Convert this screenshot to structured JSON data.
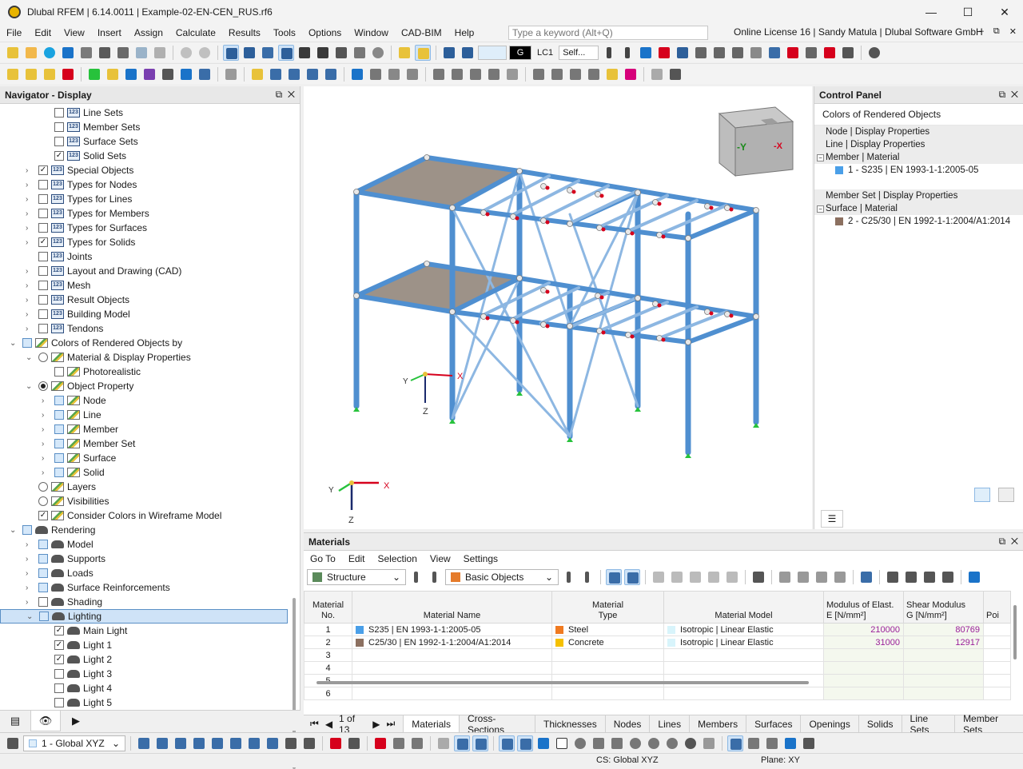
{
  "window": {
    "title": "Dlubal RFEM | 6.14.0011 | Example-02-EN-CEN_RUS.rf6",
    "controls": [
      "—",
      "☐",
      "✕"
    ]
  },
  "menu": {
    "items": [
      "File",
      "Edit",
      "View",
      "Insert",
      "Assign",
      "Calculate",
      "Results",
      "Tools",
      "Options",
      "Window",
      "CAD-BIM",
      "Help"
    ],
    "search_placeholder": "Type a keyword (Alt+Q)",
    "license": "Online License 16 | Sandy Matula | Dlubal Software GmbH",
    "mdi_controls": [
      "–",
      "⧉",
      "✕"
    ]
  },
  "toolbar": {
    "lc_type": "G",
    "lc_name": "LC1",
    "lc_desc": "Self..."
  },
  "navigator": {
    "title": "Navigator - Display",
    "items": [
      {
        "label": "Line Sets",
        "level": 3,
        "check": "off",
        "icon": "num"
      },
      {
        "label": "Member Sets",
        "level": 3,
        "check": "off",
        "icon": "num"
      },
      {
        "label": "Surface Sets",
        "level": 3,
        "check": "off",
        "icon": "num"
      },
      {
        "label": "Solid Sets",
        "level": 3,
        "check": "on",
        "icon": "num"
      },
      {
        "label": "Special Objects",
        "level": 2,
        "check": "on",
        "icon": "num",
        "exp": "›"
      },
      {
        "label": "Types for Nodes",
        "level": 2,
        "check": "off",
        "icon": "num",
        "exp": "›"
      },
      {
        "label": "Types for Lines",
        "level": 2,
        "check": "off",
        "icon": "num",
        "exp": "›"
      },
      {
        "label": "Types for Members",
        "level": 2,
        "check": "off",
        "icon": "num",
        "exp": "›"
      },
      {
        "label": "Types for Surfaces",
        "level": 2,
        "check": "off",
        "icon": "num",
        "exp": "›"
      },
      {
        "label": "Types for Solids",
        "level": 2,
        "check": "on",
        "icon": "num",
        "exp": "›"
      },
      {
        "label": "Joints",
        "level": 2,
        "check": "off",
        "icon": "num"
      },
      {
        "label": "Layout and Drawing (CAD)",
        "level": 2,
        "check": "off",
        "icon": "num",
        "exp": "›"
      },
      {
        "label": "Mesh",
        "level": 2,
        "check": "off",
        "icon": "num",
        "exp": "›"
      },
      {
        "label": "Result Objects",
        "level": 2,
        "check": "off",
        "icon": "num",
        "exp": "›"
      },
      {
        "label": "Building Model",
        "level": 2,
        "check": "off",
        "icon": "num",
        "exp": "›"
      },
      {
        "label": "Tendons",
        "level": 2,
        "check": "off",
        "icon": "num",
        "exp": "›"
      },
      {
        "label": "Colors of Rendered Objects by",
        "level": 1,
        "check": "part",
        "icon": "pal",
        "exp": "⌄"
      },
      {
        "label": "Material & Display Properties",
        "level": 2,
        "check": "radio",
        "icon": "pal",
        "exp": "⌄"
      },
      {
        "label": "Photorealistic",
        "level": 3,
        "check": "off",
        "icon": "pal"
      },
      {
        "label": "Object Property",
        "level": 2,
        "check": "radio-sel",
        "icon": "pal",
        "exp": "⌄"
      },
      {
        "label": "Node",
        "level": 3,
        "check": "part",
        "icon": "pal",
        "exp": "›"
      },
      {
        "label": "Line",
        "level": 3,
        "check": "part",
        "icon": "pal",
        "exp": "›"
      },
      {
        "label": "Member",
        "level": 3,
        "check": "part",
        "icon": "pal",
        "exp": "›"
      },
      {
        "label": "Member Set",
        "level": 3,
        "check": "part",
        "icon": "pal",
        "exp": "›"
      },
      {
        "label": "Surface",
        "level": 3,
        "check": "part",
        "icon": "pal",
        "exp": "›"
      },
      {
        "label": "Solid",
        "level": 3,
        "check": "part",
        "icon": "pal",
        "exp": "›"
      },
      {
        "label": "Layers",
        "level": 2,
        "check": "radio",
        "icon": "pal"
      },
      {
        "label": "Visibilities",
        "level": 2,
        "check": "radio",
        "icon": "pal"
      },
      {
        "label": "Consider Colors in Wireframe Model",
        "level": 2,
        "check": "on",
        "icon": "pal"
      },
      {
        "label": "Rendering",
        "level": 1,
        "check": "part",
        "icon": "pot",
        "exp": "⌄"
      },
      {
        "label": "Model",
        "level": 2,
        "check": "part",
        "icon": "pot",
        "exp": "›"
      },
      {
        "label": "Supports",
        "level": 2,
        "check": "part",
        "icon": "pot",
        "exp": "›"
      },
      {
        "label": "Loads",
        "level": 2,
        "check": "part",
        "icon": "pot",
        "exp": "›"
      },
      {
        "label": "Surface Reinforcements",
        "level": 2,
        "check": "part",
        "icon": "pot",
        "exp": "›"
      },
      {
        "label": "Shading",
        "level": 2,
        "check": "off",
        "icon": "pot",
        "exp": "›"
      },
      {
        "label": "Lighting",
        "level": 2,
        "check": "part",
        "icon": "pot",
        "exp": "⌄",
        "highlight": true
      },
      {
        "label": "Main Light",
        "level": 3,
        "check": "on",
        "icon": "pot"
      },
      {
        "label": "Light 1",
        "level": 3,
        "check": "on",
        "icon": "pot"
      },
      {
        "label": "Light 2",
        "level": 3,
        "check": "on",
        "icon": "pot"
      },
      {
        "label": "Light 3",
        "level": 3,
        "check": "off",
        "icon": "pot"
      },
      {
        "label": "Light 4",
        "level": 3,
        "check": "off",
        "icon": "pot"
      },
      {
        "label": "Light 5",
        "level": 3,
        "check": "off",
        "icon": "pot"
      }
    ]
  },
  "viewport": {
    "viewcube_labels": [
      "-Y",
      "-X"
    ],
    "axes": {
      "x": "X",
      "y": "Y",
      "z": "Z"
    },
    "colors": {
      "steel": "#4f8fd0",
      "steel_light": "#8db7e2",
      "concrete": "#8c7f73",
      "node": "#e8e8e8",
      "release": "#d6001c",
      "support": "#27c23c"
    }
  },
  "control_panel": {
    "title": "Colors of Rendered Objects",
    "rows": [
      {
        "label": "Node | Display Properties",
        "type": "grp"
      },
      {
        "label": "Line | Display Properties",
        "type": "grp"
      },
      {
        "label": "Member | Material",
        "type": "grp",
        "exp": "−"
      },
      {
        "label": "1 - S235 | EN 1993-1-1:2005-05",
        "type": "item",
        "color": "#4a9fe8"
      },
      {
        "label": "",
        "type": "blank"
      },
      {
        "label": "Member Set | Display Properties",
        "type": "grp"
      },
      {
        "label": "Surface | Material",
        "type": "grp",
        "exp": "−"
      },
      {
        "label": "2 - C25/30 | EN 1992-1-1:2004/A1:2014",
        "type": "item",
        "color": "#8c7060"
      }
    ]
  },
  "materials": {
    "title": "Materials",
    "menu": [
      "Go To",
      "Edit",
      "Selection",
      "View",
      "Settings"
    ],
    "combo1": "Structure",
    "combo2": "Basic Objects",
    "columns": [
      {
        "l1": "Material",
        "l2": "No."
      },
      {
        "l1": "",
        "l2": "Material Name"
      },
      {
        "l1": "Material",
        "l2": "Type"
      },
      {
        "l1": "",
        "l2": "Material Model"
      },
      {
        "l1": "Modulus of Elast.",
        "l2": "E [N/mm²]"
      },
      {
        "l1": "Shear Modulus",
        "l2": "G [N/mm²]"
      },
      {
        "l1": "Poi",
        "l2": ""
      }
    ],
    "rows": [
      {
        "no": "1",
        "name": "S235 | EN 1993-1-1:2005-05",
        "name_color": "#4a9fe8",
        "type": "Steel",
        "type_color": "#f07a20",
        "model": "Isotropic | Linear Elastic",
        "model_color": "#d8f4fb",
        "E": "210000",
        "G": "80769"
      },
      {
        "no": "2",
        "name": "C25/30 | EN 1992-1-1:2004/A1:2014",
        "name_color": "#8c7060",
        "type": "Concrete",
        "type_color": "#f5c000",
        "model": "Isotropic | Linear Elastic",
        "model_color": "#d8f4fb",
        "E": "31000",
        "G": "12917"
      },
      {
        "no": "3",
        "name": "",
        "type": "",
        "model": "",
        "E": "",
        "G": ""
      },
      {
        "no": "4",
        "name": "",
        "type": "",
        "model": "",
        "E": "",
        "G": ""
      },
      {
        "no": "5",
        "name": "",
        "type": "",
        "model": "",
        "E": "",
        "G": ""
      },
      {
        "no": "6",
        "name": "",
        "type": "",
        "model": "",
        "E": "",
        "G": ""
      }
    ]
  },
  "tabs": {
    "page": "1 of 13",
    "items": [
      "Materials",
      "Cross-Sections",
      "Thicknesses",
      "Nodes",
      "Lines",
      "Members",
      "Surfaces",
      "Openings",
      "Solids",
      "Line Sets",
      "Member Sets"
    ],
    "active": 0
  },
  "status": {
    "coord_system": "1 - Global XYZ",
    "cs": "CS: Global XYZ",
    "plane": "Plane: XY"
  }
}
